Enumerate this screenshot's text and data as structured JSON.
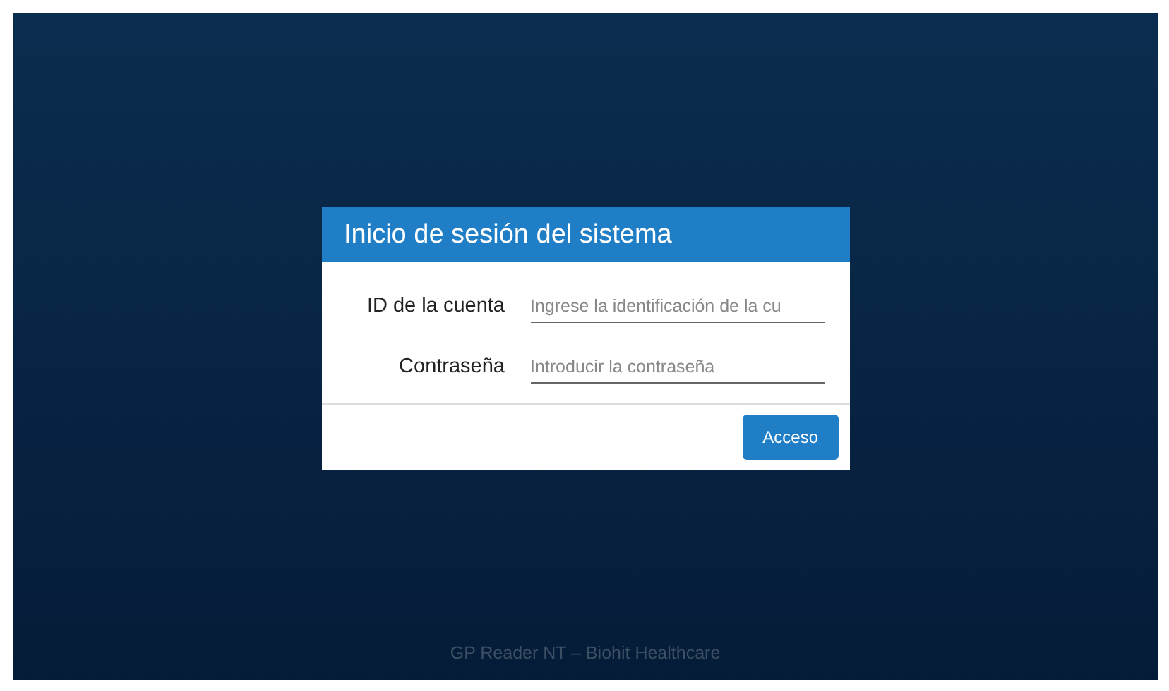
{
  "dialog": {
    "title": "Inicio de sesión del sistema",
    "fields": [
      {
        "label": "ID de la cuenta",
        "placeholder": "Ingrese la identificación de la cu"
      },
      {
        "label": "Contraseña",
        "placeholder": "Introducir la contraseña"
      }
    ],
    "buttons": [
      "Acceso"
    ]
  },
  "footer": "GP Reader NT – Biohit Healthcare"
}
